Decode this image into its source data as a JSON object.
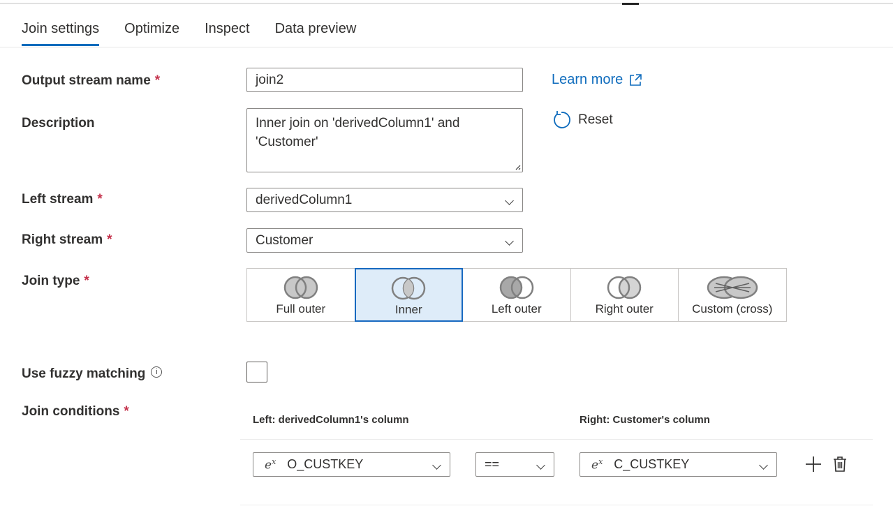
{
  "tabs": [
    {
      "label": "Join settings",
      "active": true
    },
    {
      "label": "Optimize",
      "active": false
    },
    {
      "label": "Inspect",
      "active": false
    },
    {
      "label": "Data preview",
      "active": false
    }
  ],
  "form": {
    "output_stream_label": "Output stream name",
    "output_stream_value": "join2",
    "description_label": "Description",
    "description_value": "Inner join on 'derivedColumn1' and 'Customer'",
    "left_stream_label": "Left stream",
    "left_stream_value": "derivedColumn1",
    "right_stream_label": "Right stream",
    "right_stream_value": "Customer",
    "join_type_label": "Join type",
    "fuzzy_label": "Use fuzzy matching",
    "fuzzy_checked": false,
    "join_conditions_label": "Join conditions",
    "required_mark": "*",
    "info_glyph": "i"
  },
  "actions": {
    "learn_more": "Learn more",
    "reset": "Reset"
  },
  "join_types": [
    {
      "label": "Full outer",
      "selected": false
    },
    {
      "label": "Inner",
      "selected": true
    },
    {
      "label": "Left outer",
      "selected": false
    },
    {
      "label": "Right outer",
      "selected": false
    },
    {
      "label": "Custom (cross)",
      "selected": false
    }
  ],
  "conditions": {
    "left_header": "Left: derivedColumn1's column",
    "right_header": "Right: Customer's column",
    "rows": [
      {
        "left": "O_CUSTKEY",
        "operator": "==",
        "right": "C_CUSTKEY"
      }
    ],
    "expr_glyph": "e",
    "expr_sup": "x"
  },
  "colors": {
    "accent": "#0f6cbd",
    "selected_bg": "#deecf9",
    "required": "#c4314b"
  }
}
